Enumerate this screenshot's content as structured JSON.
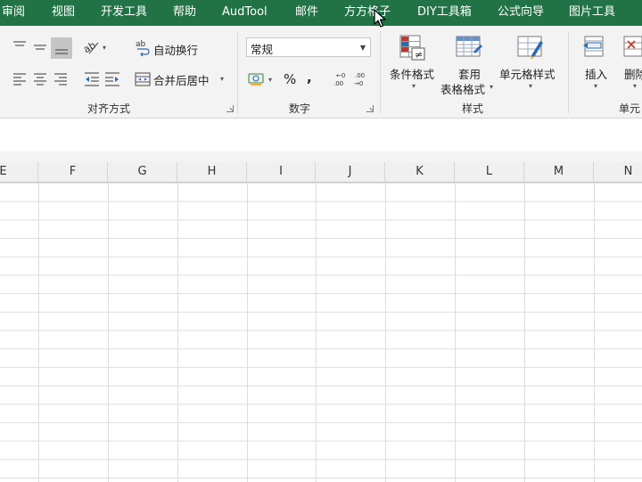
{
  "menubar": {
    "items": [
      "审阅",
      "视图",
      "开发工具",
      "帮助",
      "AudTool",
      "邮件",
      "方方格子",
      "DIY工具箱",
      "公式向导",
      "图片工具"
    ]
  },
  "ribbon": {
    "alignment": {
      "wrap_text": "自动换行",
      "merge_center": "合并后居中",
      "label": "对齐方式"
    },
    "number": {
      "format_value": "常规",
      "percent": "%",
      "comma": ",",
      "label": "数字"
    },
    "styles": {
      "conditional_format": "条件格式",
      "table_format_line1": "套用",
      "table_format_line2": "表格格式",
      "cell_styles": "单元格样式",
      "label": "样式"
    },
    "cells": {
      "insert": "插入",
      "delete": "删除",
      "label": "单元"
    }
  },
  "sheet": {
    "columns": [
      "E",
      "F",
      "G",
      "H",
      "I",
      "J",
      "K",
      "L",
      "M",
      "N"
    ]
  },
  "colors": {
    "menubar_bg": "#217346",
    "ribbon_bg": "#f3f3f3",
    "gridline": "#dedede"
  }
}
